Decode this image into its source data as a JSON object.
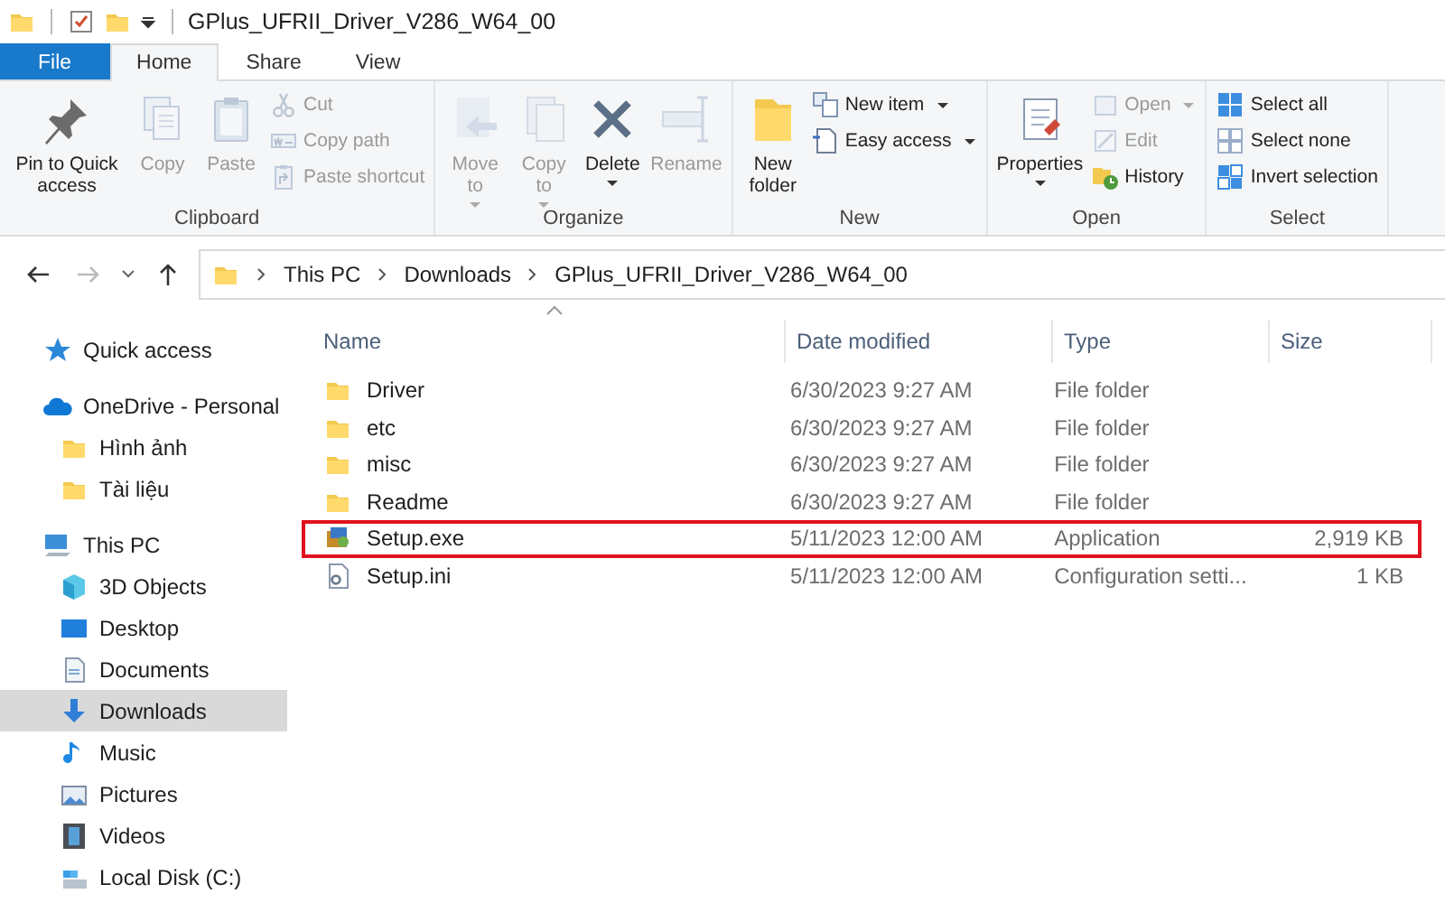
{
  "window": {
    "title": "GPlus_UFRII_Driver_V286_W64_00"
  },
  "tabs": [
    {
      "label": "File",
      "kind": "file",
      "selected": false
    },
    {
      "label": "Home",
      "kind": "tab",
      "selected": true
    },
    {
      "label": "Share",
      "kind": "tab",
      "selected": false
    },
    {
      "label": "View",
      "kind": "tab",
      "selected": false
    }
  ],
  "ribbon": {
    "groups": [
      {
        "label": "Clipboard",
        "items": [
          {
            "label": "Pin to Quick access",
            "kind": "large",
            "disabled": false,
            "menu": false
          },
          {
            "label": "Copy",
            "kind": "large",
            "disabled": true,
            "menu": false
          },
          {
            "label": "Paste",
            "kind": "large",
            "disabled": true,
            "menu": false
          },
          {
            "label": "Cut",
            "kind": "small",
            "disabled": true,
            "menu": false
          },
          {
            "label": "Copy path",
            "kind": "small",
            "disabled": true,
            "menu": false
          },
          {
            "label": "Paste shortcut",
            "kind": "small",
            "disabled": true,
            "menu": false
          }
        ]
      },
      {
        "label": "Organize",
        "items": [
          {
            "label": "Move to",
            "kind": "large",
            "disabled": true,
            "menu": true
          },
          {
            "label": "Copy to",
            "kind": "large",
            "disabled": true,
            "menu": true
          },
          {
            "label": "Delete",
            "kind": "large",
            "disabled": false,
            "menu": true
          },
          {
            "label": "Rename",
            "kind": "large",
            "disabled": true,
            "menu": false
          }
        ]
      },
      {
        "label": "New",
        "items": [
          {
            "label": "New folder",
            "kind": "large",
            "disabled": false,
            "menu": false
          },
          {
            "label": "New item",
            "kind": "small",
            "disabled": false,
            "menu": true
          },
          {
            "label": "Easy access",
            "kind": "small",
            "disabled": false,
            "menu": true
          }
        ]
      },
      {
        "label": "Open",
        "items": [
          {
            "label": "Properties",
            "kind": "large",
            "disabled": false,
            "menu": true
          },
          {
            "label": "Open",
            "kind": "small",
            "disabled": true,
            "menu": true
          },
          {
            "label": "Edit",
            "kind": "small",
            "disabled": true,
            "menu": false
          },
          {
            "label": "History",
            "kind": "small",
            "disabled": false,
            "menu": false
          }
        ]
      },
      {
        "label": "Select",
        "items": [
          {
            "label": "Select all",
            "kind": "small",
            "disabled": false,
            "menu": false
          },
          {
            "label": "Select none",
            "kind": "small",
            "disabled": false,
            "menu": false
          },
          {
            "label": "Invert selection",
            "kind": "small",
            "disabled": false,
            "menu": false
          }
        ]
      }
    ]
  },
  "address": {
    "crumbs": [
      "This PC",
      "Downloads",
      "GPlus_UFRII_Driver_V286_W64_00"
    ]
  },
  "sidebar": {
    "items": [
      {
        "label": "Quick access",
        "selected": false
      },
      {
        "label": "OneDrive - Personal",
        "selected": false,
        "children": [
          {
            "label": "Hình ảnh",
            "selected": false
          },
          {
            "label": "Tài liệu",
            "selected": false
          }
        ]
      },
      {
        "label": "This PC",
        "selected": false,
        "children": [
          {
            "label": "3D Objects",
            "selected": false
          },
          {
            "label": "Desktop",
            "selected": false
          },
          {
            "label": "Documents",
            "selected": false
          },
          {
            "label": "Downloads",
            "selected": true
          },
          {
            "label": "Music",
            "selected": false
          },
          {
            "label": "Pictures",
            "selected": false
          },
          {
            "label": "Videos",
            "selected": false
          },
          {
            "label": "Local Disk (C:)",
            "selected": false
          }
        ]
      }
    ]
  },
  "table": {
    "columns": [
      "Name",
      "Date modified",
      "Type",
      "Size"
    ],
    "rows": [
      {
        "kind": "folder",
        "name": "Driver",
        "date_modified": "6/30/2023 9:27 AM",
        "type": "File folder",
        "highlighted": false
      },
      {
        "kind": "folder",
        "name": "etc",
        "date_modified": "6/30/2023 9:27 AM",
        "type": "File folder",
        "highlighted": false
      },
      {
        "kind": "folder",
        "name": "misc",
        "date_modified": "6/30/2023 9:27 AM",
        "type": "File folder",
        "highlighted": false
      },
      {
        "kind": "folder",
        "name": "Readme",
        "date_modified": "6/30/2023 9:27 AM",
        "type": "File folder",
        "highlighted": false
      },
      {
        "kind": "application",
        "name": "Setup.exe",
        "date_modified": "5/11/2023 12:00 AM",
        "type": "Application",
        "size": "2,919 KB",
        "highlighted": true
      },
      {
        "kind": "settings",
        "name": "Setup.ini",
        "date_modified": "5/11/2023 12:00 AM",
        "type": "Configuration setti...",
        "size": "1 KB",
        "highlighted": false
      }
    ]
  }
}
